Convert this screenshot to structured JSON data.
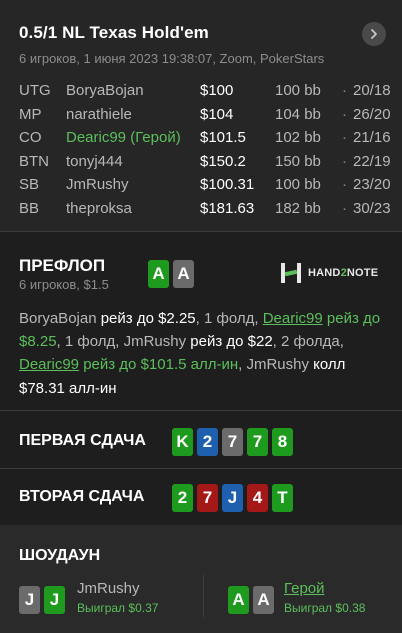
{
  "header": {
    "title": "0.5/1 NL Texas Hold'em",
    "subtitle": "6 игроков, 1 июня 2023 19:38:07, Zoom, PokerStars",
    "nav_icon": "chevron-right-icon"
  },
  "players": [
    {
      "pos": "UTG",
      "name": "BoryaBojan",
      "stack": "$100",
      "bb": "100 bb",
      "dot": "·",
      "count": "20/18",
      "hero": false
    },
    {
      "pos": "MP",
      "name": "narathiele",
      "stack": "$104",
      "bb": "104 bb",
      "dot": "·",
      "count": "26/20",
      "hero": false
    },
    {
      "pos": "CO",
      "name": "Dearic99 (Герой)",
      "stack": "$101.5",
      "bb": "102 bb",
      "dot": "·",
      "count": "21/16",
      "hero": true
    },
    {
      "pos": "BTN",
      "name": "tonyj444",
      "stack": "$150.2",
      "bb": "150 bb",
      "dot": "·",
      "count": "22/19",
      "hero": false
    },
    {
      "pos": "SB",
      "name": "JmRushy",
      "stack": "$100.31",
      "bb": "100 bb",
      "dot": "·",
      "count": "23/20",
      "hero": false
    },
    {
      "pos": "BB",
      "name": "theproksa",
      "stack": "$181.63",
      "bb": "182 bb",
      "dot": "·",
      "count": "30/23",
      "hero": false
    }
  ],
  "preflop": {
    "label": "ПРЕФЛОП",
    "sub": "6 игроков, $1.5",
    "cards": [
      {
        "rank": "A",
        "color": "green"
      },
      {
        "rank": "A",
        "color": "grey"
      }
    ],
    "logo_mark": "H",
    "logo_text_a": "HAND",
    "logo_text_b": "2",
    "logo_text_c": "NOTE",
    "action": [
      {
        "t": "BoryaBojan ",
        "s": ""
      },
      {
        "t": "рейз до $2.25",
        "s": "w"
      },
      {
        "t": ", 1 фолд, ",
        "s": ""
      },
      {
        "t": "Dearic99",
        "s": "g u"
      },
      {
        "t": " рейз до $8.25",
        "s": "g"
      },
      {
        "t": ", 1 фолд, JmRushy ",
        "s": ""
      },
      {
        "t": "рейз до $22",
        "s": "w"
      },
      {
        "t": ", 2 фолда, ",
        "s": ""
      },
      {
        "t": "Dearic99",
        "s": "g u"
      },
      {
        "t": " рейз до $101.5 алл-ин",
        "s": "g"
      },
      {
        "t": ", JmRushy ",
        "s": ""
      },
      {
        "t": "колл $78.31 алл-ин",
        "s": "w"
      }
    ]
  },
  "first_run": {
    "label": "ПЕРВАЯ СДАЧА",
    "cards": [
      {
        "rank": "K",
        "color": "green"
      },
      {
        "rank": "2",
        "color": "blue"
      },
      {
        "rank": "7",
        "color": "grey"
      },
      {
        "rank": "7",
        "color": "green"
      },
      {
        "rank": "8",
        "color": "green"
      }
    ]
  },
  "second_run": {
    "label": "ВТОРАЯ СДАЧА",
    "cards": [
      {
        "rank": "2",
        "color": "green"
      },
      {
        "rank": "7",
        "color": "red"
      },
      {
        "rank": "J",
        "color": "blue"
      },
      {
        "rank": "4",
        "color": "red"
      },
      {
        "rank": "T",
        "color": "green"
      }
    ]
  },
  "showdown": {
    "label": "ШОУДАУН",
    "villain": {
      "name": "JmRushy",
      "won": "Выиграл $0.37",
      "cards": [
        {
          "rank": "J",
          "color": "grey"
        },
        {
          "rank": "J",
          "color": "green"
        }
      ]
    },
    "hero": {
      "name": "Герой",
      "won": "Выиграл $0.38",
      "cards": [
        {
          "rank": "A",
          "color": "green"
        },
        {
          "rank": "A",
          "color": "grey"
        }
      ]
    }
  }
}
